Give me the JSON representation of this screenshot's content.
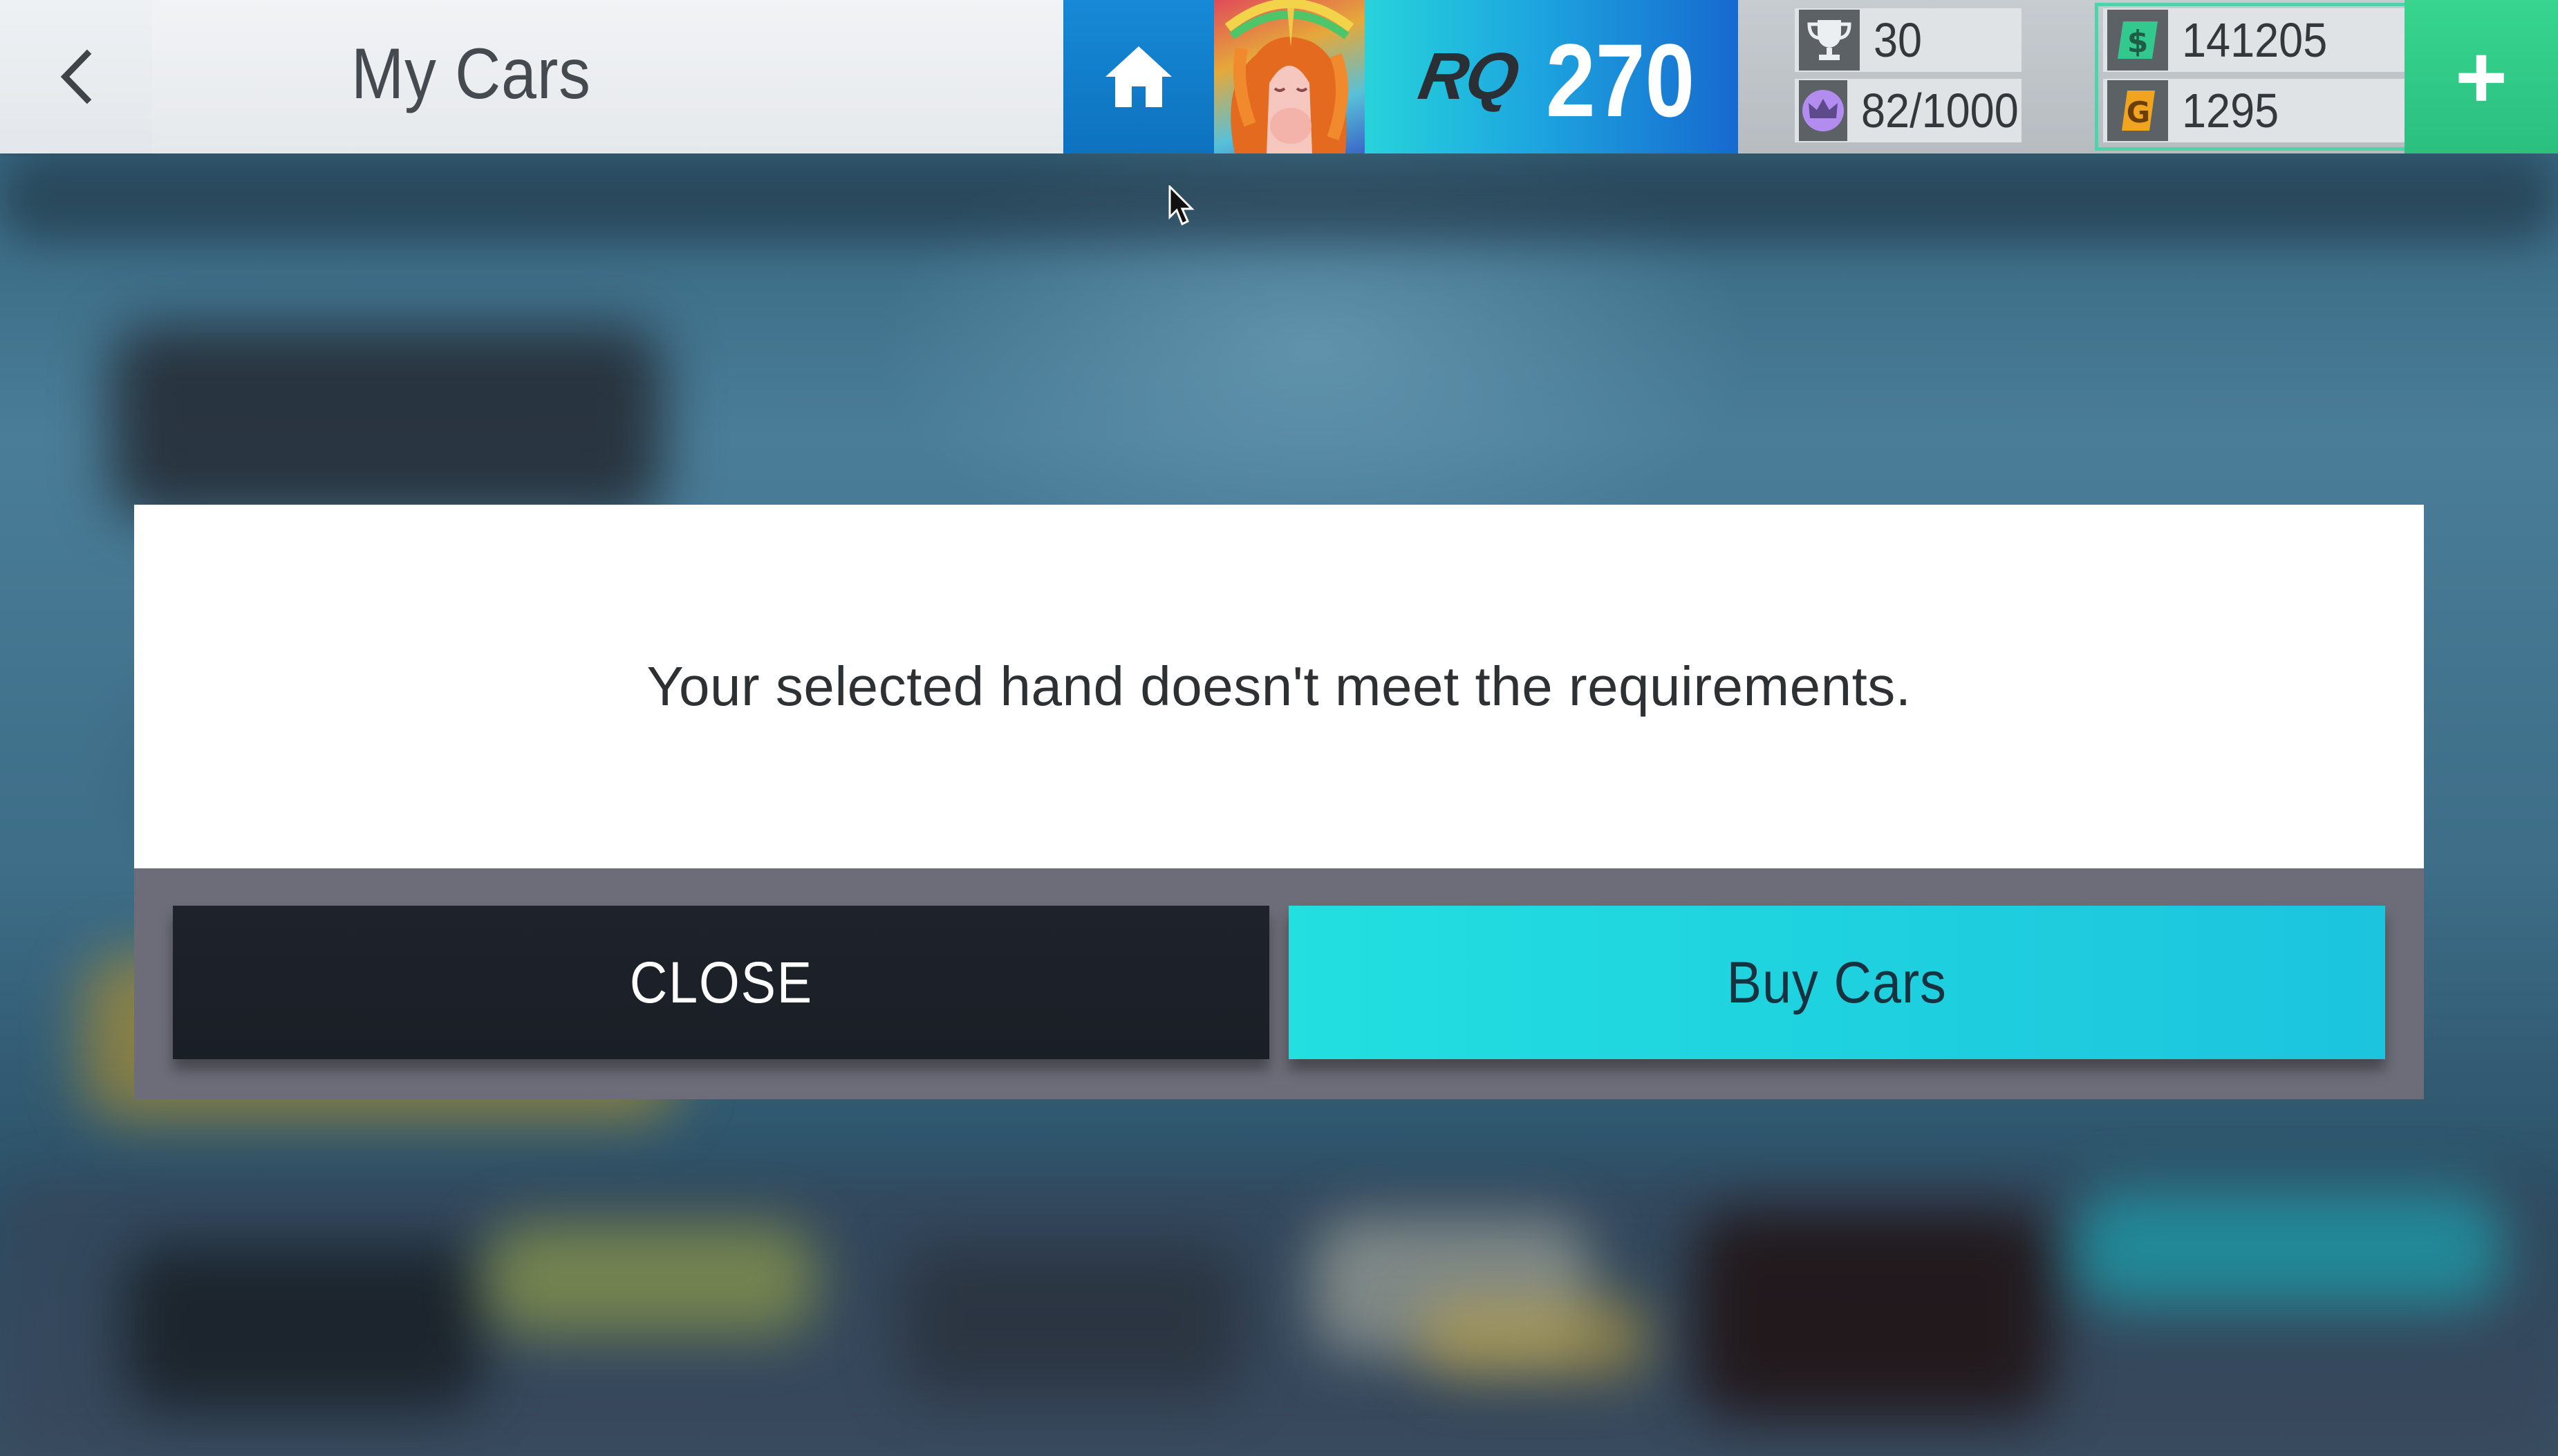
{
  "header": {
    "title": "My Cars",
    "rq_label": "RQ",
    "rq_value": "270"
  },
  "stats": {
    "trophies": "30",
    "crowns": "82/1000",
    "cash": "141205",
    "gold": "1295"
  },
  "icons": {
    "back": "chevron-left-icon",
    "home": "home-icon",
    "trophy": "trophy-icon",
    "crown": "crown-icon",
    "cash": "dollar-icon",
    "gold": "gold-coin-icon",
    "plus": "plus-icon"
  },
  "dialog": {
    "message": "Your selected hand doesn't meet the requirements.",
    "close_label": "CLOSE",
    "buy_label": "Buy Cars"
  },
  "colors": {
    "home_blue": "#1789d6",
    "rq_gradient_start": "#27d3db",
    "rq_gradient_end": "#1769cf",
    "plus_green": "#37d58f",
    "cash_green": "#4fd4a9",
    "buy_cyan": "#22dfe0",
    "close_dark": "#1e232b"
  }
}
